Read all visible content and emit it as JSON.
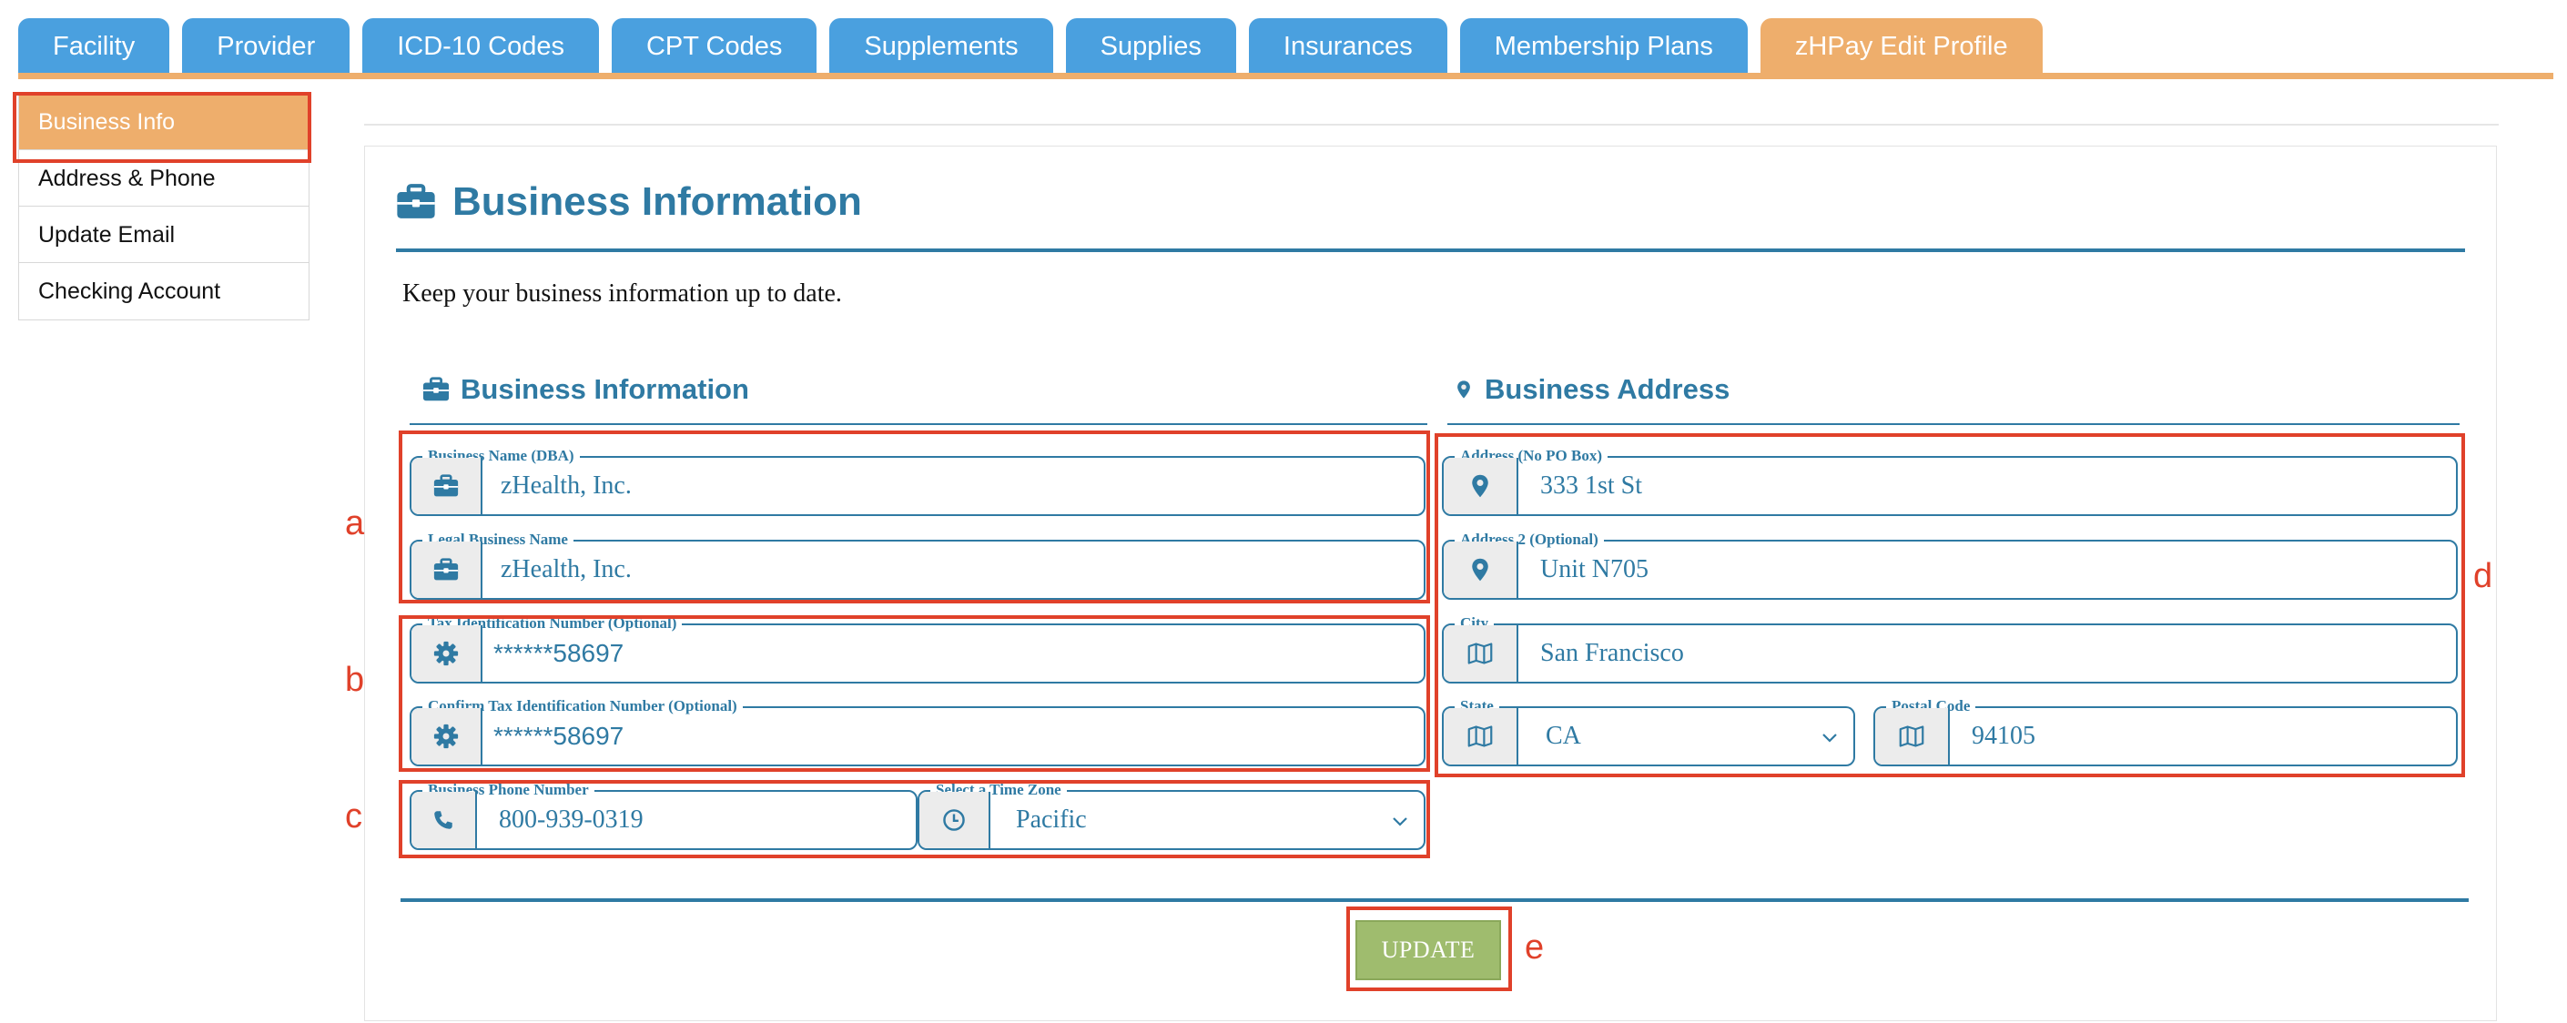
{
  "tabs": [
    {
      "label": "Facility"
    },
    {
      "label": "Provider"
    },
    {
      "label": "ICD-10 Codes"
    },
    {
      "label": "CPT Codes"
    },
    {
      "label": "Supplements"
    },
    {
      "label": "Supplies"
    },
    {
      "label": "Insurances"
    },
    {
      "label": "Membership Plans"
    },
    {
      "label": "zHPay Edit Profile",
      "active": true
    }
  ],
  "subnav": [
    {
      "label": "Business Info",
      "active": true
    },
    {
      "label": "Address & Phone"
    },
    {
      "label": "Update Email"
    },
    {
      "label": "Checking Account"
    }
  ],
  "page": {
    "title": "Business Information",
    "intro": "Keep your business information up to date."
  },
  "business_info": {
    "heading": "Business Information",
    "business_name": {
      "label": "Business Name (DBA)",
      "value": "zHealth, Inc.",
      "icon": "briefcase-icon"
    },
    "legal_name": {
      "label": "Legal Business Name",
      "value": "zHealth, Inc.",
      "icon": "briefcase-icon"
    },
    "tax_id": {
      "label": "Tax Identification Number (Optional)",
      "value": "******58697",
      "icon": "gear-icon"
    },
    "confirm_tax_id": {
      "label": "Confirm Tax Identification Number (Optional)",
      "value": "******58697",
      "icon": "gear-icon"
    },
    "phone": {
      "label": "Business Phone Number",
      "value": "800-939-0319",
      "icon": "phone-icon"
    },
    "time_zone": {
      "label": "Select a Time Zone",
      "value": "Pacific",
      "icon": "clock-icon"
    }
  },
  "business_address": {
    "heading": "Business Address",
    "address1": {
      "label": "Address (No PO Box)",
      "value": "333 1st St",
      "icon": "map-marker-icon"
    },
    "address2": {
      "label": "Address 2 (Optional)",
      "value": "Unit N705",
      "icon": "map-marker-icon"
    },
    "city": {
      "label": "City",
      "value": "San Francisco",
      "icon": "map-icon"
    },
    "state": {
      "label": "State",
      "value": "CA",
      "icon": "map-icon"
    },
    "postal_code": {
      "label": "Postal Code",
      "value": "94105",
      "icon": "map-icon"
    }
  },
  "update_button": {
    "label": "UPDATE"
  },
  "annotations": {
    "a": "a",
    "b": "b",
    "c": "c",
    "d": "d",
    "e": "e"
  },
  "colors": {
    "tab_blue": "#4aa0df",
    "tab_active_orange": "#eeae6c",
    "heading_blue": "#2f7aa3",
    "update_green": "#9fbc6e",
    "annotation_red": "#e0412a"
  }
}
